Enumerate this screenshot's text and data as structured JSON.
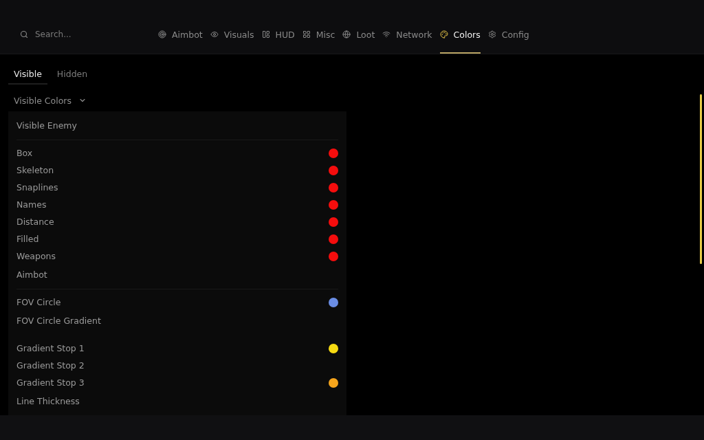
{
  "search": {
    "placeholder": "Search..."
  },
  "nav_tabs": [
    {
      "label": "Aimbot",
      "selected": false
    },
    {
      "label": "Visuals",
      "selected": false
    },
    {
      "label": "HUD",
      "selected": false
    },
    {
      "label": "Misc",
      "selected": false
    },
    {
      "label": "Loot",
      "selected": false
    },
    {
      "label": "Network",
      "selected": false
    },
    {
      "label": "Colors",
      "selected": true
    },
    {
      "label": "Config",
      "selected": false
    }
  ],
  "sub_tabs": [
    {
      "label": "Visible",
      "selected": true
    },
    {
      "label": "Hidden",
      "selected": false
    }
  ],
  "dropdown": {
    "label": "Visible Colors"
  },
  "rows": [
    {
      "kind": "section",
      "label": "Visible Enemy"
    },
    {
      "kind": "entry",
      "label": "Box",
      "color": "#f50d0d"
    },
    {
      "kind": "entry",
      "label": "Skeleton",
      "color": "#f50d0d"
    },
    {
      "kind": "entry",
      "label": "Snaplines",
      "color": "#f50d0d"
    },
    {
      "kind": "entry",
      "label": "Names",
      "color": "#f50d0d"
    },
    {
      "kind": "entry",
      "label": "Distance",
      "color": "#f50d0d"
    },
    {
      "kind": "entry",
      "label": "Filled",
      "color": "#f50d0d"
    },
    {
      "kind": "entry",
      "label": "Weapons",
      "color": "#f50d0d"
    },
    {
      "kind": "section",
      "label": "Aimbot"
    },
    {
      "kind": "entry",
      "label": "FOV Circle",
      "color": "#6a8de4"
    },
    {
      "kind": "subsection",
      "label": "FOV Circle Gradient"
    },
    {
      "kind": "entry",
      "label": "Gradient Stop 1",
      "color": "#f6da12"
    },
    {
      "kind": "entry",
      "label": "Gradient Stop 2"
    },
    {
      "kind": "entry",
      "label": "Gradient Stop 3",
      "color": "#f6a51c"
    },
    {
      "kind": "subsection",
      "label": "Line Thickness"
    }
  ]
}
